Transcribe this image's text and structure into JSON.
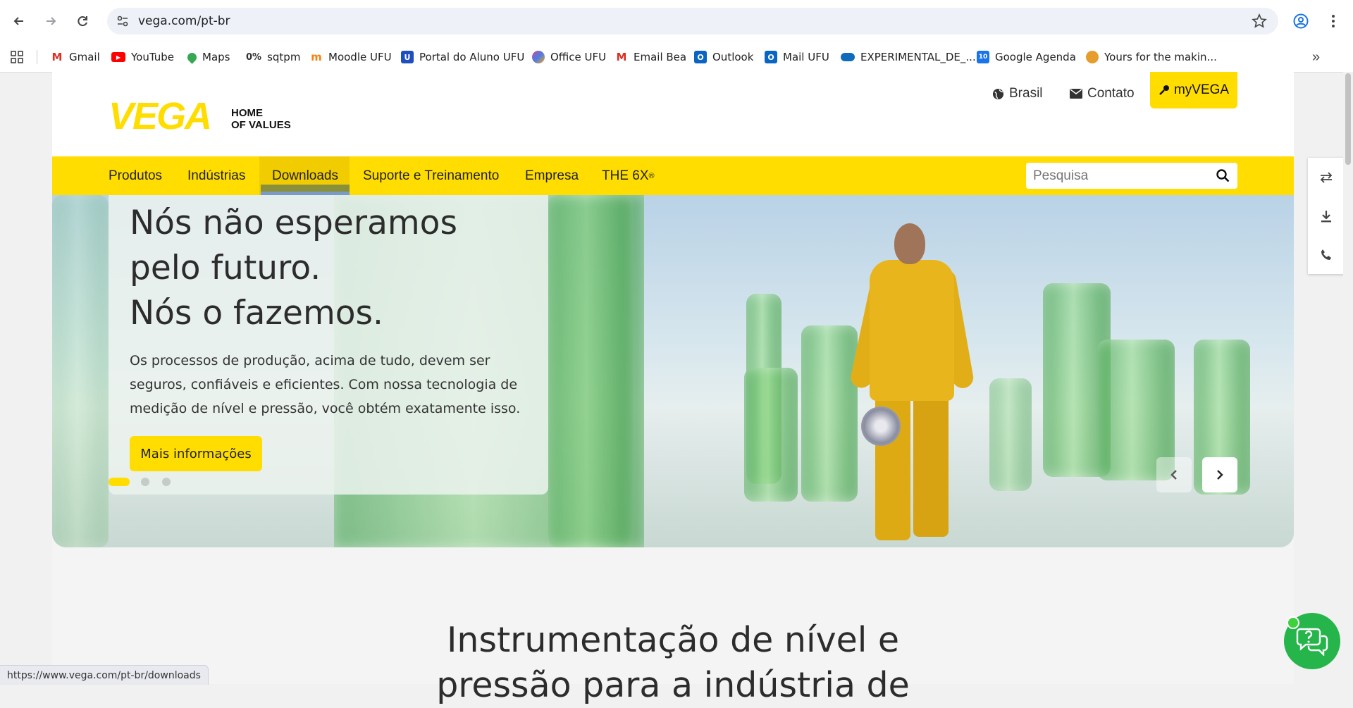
{
  "browser": {
    "url": "vega.com/pt-br",
    "status_url": "https://www.vega.com/pt-br/downloads",
    "bookmarks": [
      {
        "label": "Gmail",
        "icon": "gmail-icon",
        "color": "#d93025"
      },
      {
        "label": "YouTube",
        "icon": "youtube-icon",
        "color": "#ff0000"
      },
      {
        "label": "Maps",
        "icon": "maps-icon",
        "color": "#34a853"
      },
      {
        "label": "sqtpm",
        "prefix": "0%",
        "icon": "sqtpm-icon",
        "color": "#555555"
      },
      {
        "label": "Moodle UFU",
        "icon": "moodle-icon",
        "color": "#f98012"
      },
      {
        "label": "Portal do Aluno UFU",
        "icon": "ufu-icon",
        "color": "#1f4fbf"
      },
      {
        "label": "Office UFU",
        "icon": "office-icon",
        "color": "#d04a8e"
      },
      {
        "label": "Email Bea",
        "icon": "gmail-icon",
        "color": "#d93025"
      },
      {
        "label": "Outlook",
        "icon": "outlook-icon",
        "color": "#0a64c2"
      },
      {
        "label": "Mail UFU",
        "icon": "outlook-icon",
        "color": "#0a64c2"
      },
      {
        "label": "EXPERIMENTAL_DE_...",
        "icon": "onedrive-icon",
        "color": "#0f6cbd"
      },
      {
        "label": "Google Agenda",
        "icon": "calendar-icon",
        "color": "#1a73e8"
      },
      {
        "label": "Yours for the makin...",
        "icon": "bookmark-emoji-icon",
        "color": "#e59d2d"
      }
    ]
  },
  "site": {
    "logo_text": "VEGA",
    "logo_tagline_1": "HOME",
    "logo_tagline_2": "OF VALUES",
    "top_links": {
      "country": "Brasil",
      "contact": "Contato",
      "account": "myVEGA"
    },
    "nav": [
      "Produtos",
      "Indústrias",
      "Downloads",
      "Suporte e Treinamento",
      "Empresa",
      "THE 6X"
    ],
    "nav_superscript": "®",
    "search_placeholder": "Pesquisa",
    "hero": {
      "title": "Nós não esperamos\npelo futuro.\nNós o fazemos.",
      "text": "Os processos de produção, acima de tudo, devem ser seguros, confiáveis e eficientes. Com nossa tecnologia de medição de nível e pressão, você obtém exatamente isso.",
      "cta": "Mais informações",
      "slide_count": 3,
      "active_slide": 1
    },
    "section_title": "Instrumentação de nível e\npressão para a indústria de"
  },
  "colors": {
    "brand_yellow": "#ffdd00",
    "chat_green": "#25b54a"
  }
}
